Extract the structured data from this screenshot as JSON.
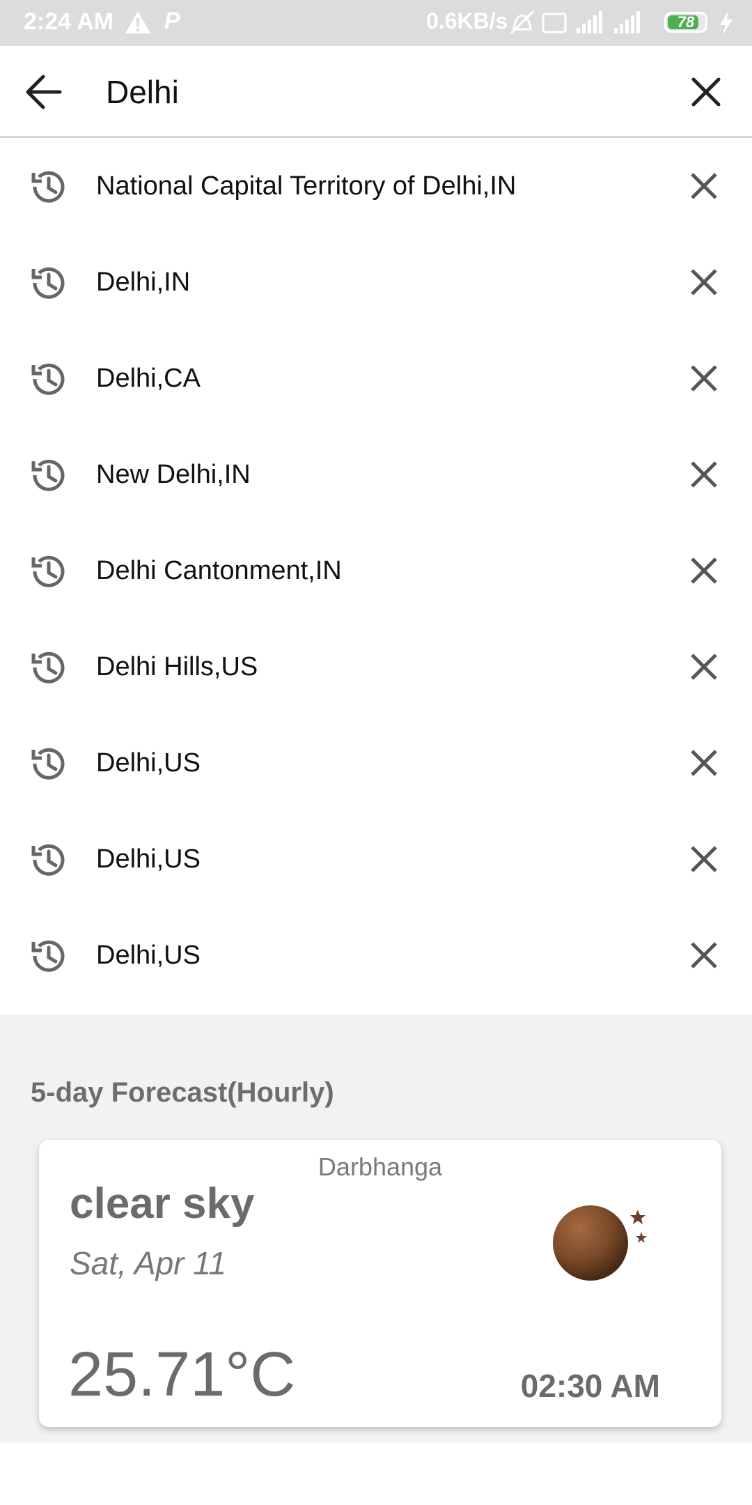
{
  "status_bar": {
    "time": "2:24 AM",
    "p_icon": "P",
    "network_speed": "0.6KB/s",
    "battery_level": "78",
    "icons": [
      "warning-icon",
      "p-icon",
      "mute-icon",
      "volte-icon",
      "signal-4g-icon",
      "signal-icon",
      "battery-icon",
      "charging-icon"
    ]
  },
  "search": {
    "query": "Delhi"
  },
  "history": [
    {
      "label": "National Capital Territory of Delhi,IN"
    },
    {
      "label": "Delhi,IN"
    },
    {
      "label": "Delhi,CA"
    },
    {
      "label": "New Delhi,IN"
    },
    {
      "label": "Delhi Cantonment,IN"
    },
    {
      "label": "Delhi Hills,US"
    },
    {
      "label": "Delhi,US"
    },
    {
      "label": "Delhi,US"
    },
    {
      "label": "Delhi,US"
    }
  ],
  "forecast": {
    "section_title": "5-day Forecast(Hourly)",
    "city": "Darbhanga",
    "condition": "clear sky",
    "date": "Sat, Apr 11",
    "temperature": "25.71°C",
    "time": "02:30 AM",
    "icon": "night-clear-icon"
  },
  "colors": {
    "accent_text": "#6b6b6b",
    "moon": "#7a4a2a",
    "battery_green": "#4caf50"
  }
}
